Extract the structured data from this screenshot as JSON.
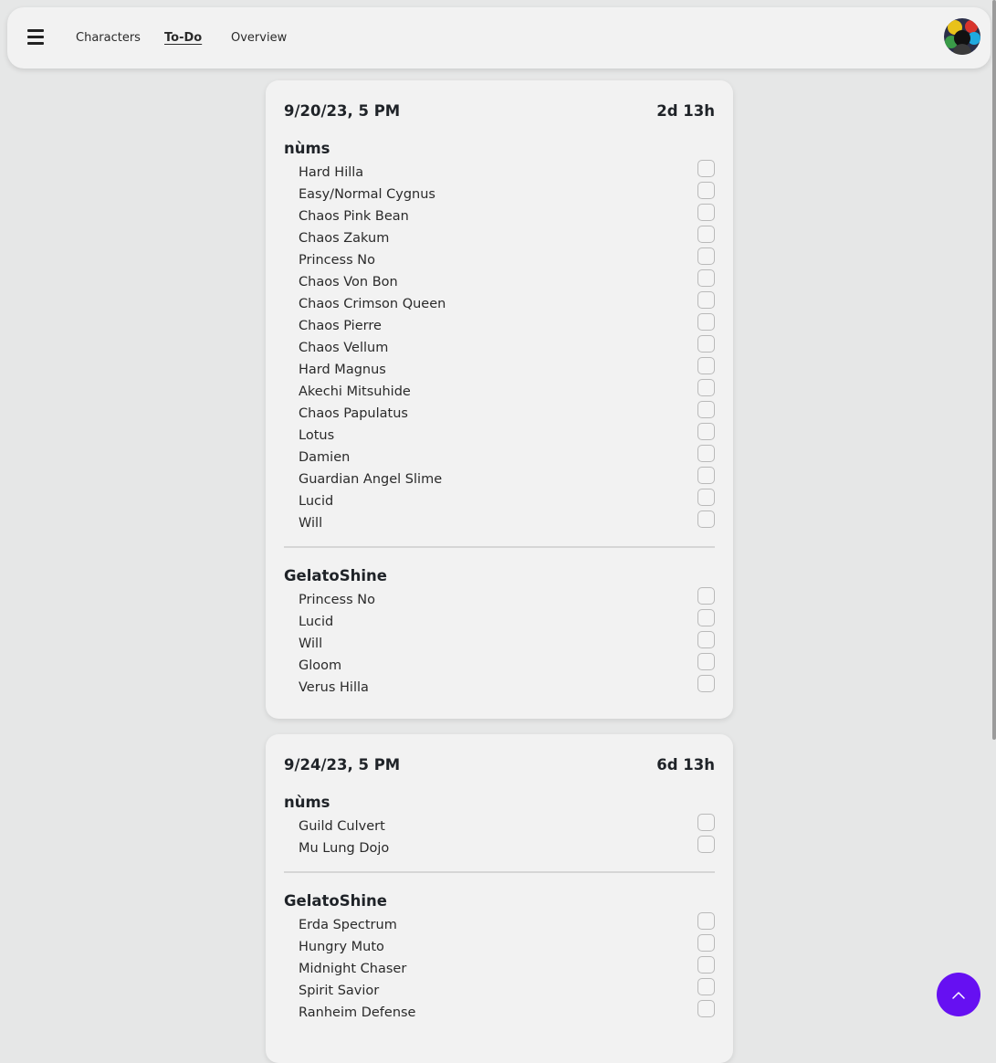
{
  "nav": {
    "links": [
      {
        "label": "Characters"
      },
      {
        "label": "To-Do"
      },
      {
        "label": "Overview"
      }
    ],
    "active": "To-Do"
  },
  "colors": {
    "accent": "#6610f2",
    "background": "#e6e7e7",
    "card": "#f2f2f2"
  },
  "cards": [
    {
      "date": "9/20/23, 5 PM",
      "remaining": "2d 13h",
      "groups": [
        {
          "character": "nùms",
          "bosses": [
            "Hard Hilla",
            "Easy/Normal Cygnus",
            "Chaos Pink Bean",
            "Chaos Zakum",
            "Princess No",
            "Chaos Von Bon",
            "Chaos Crimson Queen",
            "Chaos Pierre",
            "Chaos Vellum",
            "Hard Magnus",
            "Akechi Mitsuhide",
            "Chaos Papulatus",
            "Lotus",
            "Damien",
            "Guardian Angel Slime",
            "Lucid",
            "Will"
          ]
        },
        {
          "character": "GelatoShine",
          "bosses": [
            "Princess No",
            "Lucid",
            "Will",
            "Gloom",
            "Verus Hilla"
          ]
        }
      ]
    },
    {
      "date": "9/24/23, 5 PM",
      "remaining": "6d 13h",
      "groups": [
        {
          "character": "nùms",
          "bosses": [
            "Guild Culvert",
            "Mu Lung Dojo"
          ]
        },
        {
          "character": "GelatoShine",
          "bosses": [
            "Erda Spectrum",
            "Hungry Muto",
            "Midnight Chaser",
            "Spirit Savior",
            "Ranheim Defense"
          ]
        }
      ]
    }
  ]
}
